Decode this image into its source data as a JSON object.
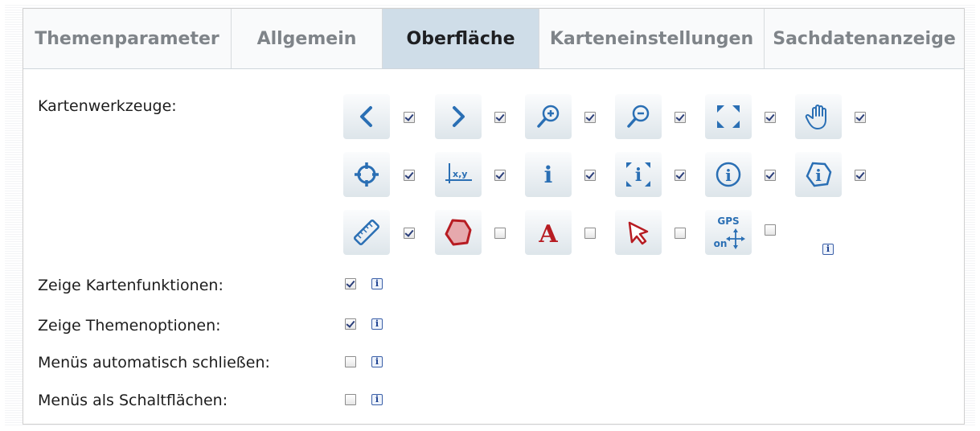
{
  "tabs": [
    {
      "label": "Themenparameter",
      "active": false
    },
    {
      "label": "Allgemein",
      "active": false
    },
    {
      "label": "Oberfläche",
      "active": true
    },
    {
      "label": "Karteneinstellungen",
      "active": false
    },
    {
      "label": "Sachdatenanzeige",
      "active": false
    }
  ],
  "map_tools": {
    "label": "Kartenwerkzeuge:",
    "tools": [
      {
        "icon": "back-arrow-icon",
        "checked": true
      },
      {
        "icon": "forward-arrow-icon",
        "checked": true
      },
      {
        "icon": "zoom-in-icon",
        "checked": true
      },
      {
        "icon": "zoom-out-icon",
        "checked": true
      },
      {
        "icon": "full-extent-icon",
        "checked": true
      },
      {
        "icon": "pan-hand-icon",
        "checked": true
      },
      {
        "icon": "crosshair-icon",
        "checked": true
      },
      {
        "icon": "coordinates-xy-icon",
        "checked": true
      },
      {
        "icon": "info-i-icon",
        "checked": true
      },
      {
        "icon": "info-area-icon",
        "checked": true
      },
      {
        "icon": "info-circle-icon",
        "checked": true
      },
      {
        "icon": "info-polygon-icon",
        "checked": true
      },
      {
        "icon": "ruler-icon",
        "checked": true
      },
      {
        "icon": "polygon-icon",
        "checked": false
      },
      {
        "icon": "text-a-icon",
        "checked": false
      },
      {
        "icon": "select-arrow-icon",
        "checked": false
      },
      {
        "icon": "gps-icon",
        "checked": false
      }
    ],
    "gps_icon_text_top": "GPS",
    "gps_icon_text_bottom": "on",
    "info_glyph": "i"
  },
  "options": [
    {
      "label": "Zeige Kartenfunktionen:",
      "checked": true
    },
    {
      "label": "Zeige Themenoptionen:",
      "checked": true
    },
    {
      "label": "Menüs automatisch schließen:",
      "checked": false
    },
    {
      "label": "Menüs als Schaltflächen:",
      "checked": false
    }
  ],
  "colors": {
    "tool_blue": "#2a6fb4",
    "tool_red": "#b71c22",
    "active_tab_bg": "#cfdde8"
  }
}
